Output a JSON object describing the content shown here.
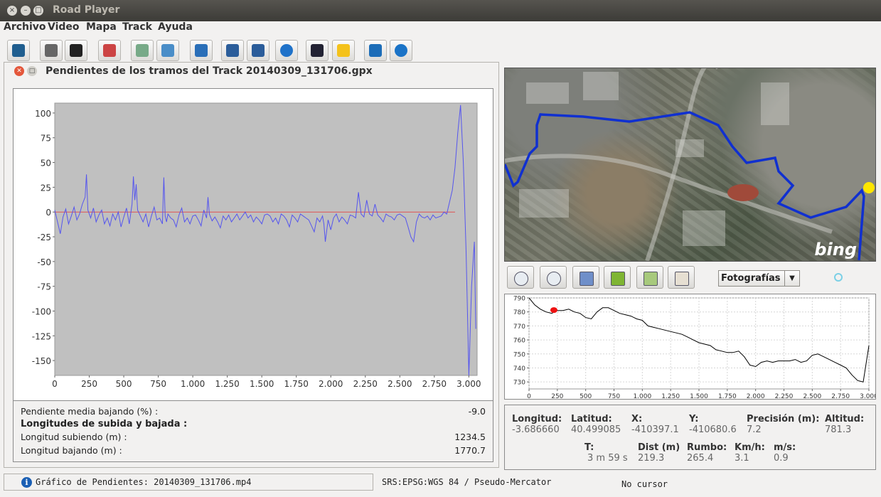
{
  "window": {
    "title": "Road Player"
  },
  "menu": [
    "Archivo",
    "Video",
    "Mapa",
    "Track",
    "Ayuda"
  ],
  "toolbar": {
    "buttons": [
      {
        "name": "open-video-icon",
        "color": "#1f5e8f"
      },
      {
        "name": "camera-icon",
        "color": "#666"
      },
      {
        "name": "film-icon",
        "color": "#222"
      },
      {
        "name": "map-pin-icon",
        "color": "#c44"
      },
      {
        "name": "database-add-icon",
        "color": "#7a8"
      },
      {
        "name": "layers-icon",
        "color": "#4a8ec8"
      },
      {
        "name": "chart-icon",
        "color": "#2a6fb8"
      },
      {
        "name": "save-icon",
        "color": "#2b5d9a"
      },
      {
        "name": "save-as-icon",
        "color": "#2b5d9a"
      },
      {
        "name": "globe-icon",
        "color": "#1f72c9"
      },
      {
        "name": "pen-icon",
        "color": "#223"
      },
      {
        "name": "waypoint-sign-icon",
        "color": "#f4c21b"
      },
      {
        "name": "help-book-icon",
        "color": "#1c6db8"
      },
      {
        "name": "info-icon",
        "color": "#1a73c7"
      }
    ]
  },
  "slope_window": {
    "title": "Pendientes de los tramos del Track 20140309_131706.gpx",
    "stats": {
      "mean_down_label": "Pendiente media bajando (%) :",
      "mean_down_value": "-9.0",
      "section_title": "Longitudes de subida y bajada :",
      "up_label": "Longitud subiendo (m) :",
      "up_value": "1234.5",
      "down_label": "Longitud bajando (m) :",
      "down_value": "1770.7"
    }
  },
  "chart_data": [
    {
      "type": "line",
      "title": "",
      "xlabel": "",
      "ylabel": "",
      "xlim": [
        0,
        3060
      ],
      "ylim": [
        -165,
        110
      ],
      "x_ticks": [
        "0",
        "250",
        "500",
        "750",
        "1.000",
        "1.250",
        "1.500",
        "1.750",
        "2.000",
        "2.250",
        "2.500",
        "2.750",
        "3.000"
      ],
      "y_ticks": [
        "100",
        "75",
        "50",
        "25",
        "0",
        "-25",
        "-50",
        "-75",
        "-100",
        "-125",
        "-150"
      ],
      "grid": false,
      "background": "#c0c0c0",
      "reference_line": {
        "y": 0,
        "color": "#e05050"
      },
      "series": [
        {
          "color": "#5555ee",
          "x": [
            0,
            20,
            40,
            60,
            80,
            100,
            120,
            140,
            160,
            180,
            200,
            220,
            230,
            240,
            260,
            280,
            300,
            320,
            340,
            360,
            380,
            400,
            420,
            440,
            460,
            480,
            500,
            520,
            540,
            560,
            570,
            580,
            590,
            600,
            620,
            640,
            660,
            680,
            700,
            720,
            740,
            760,
            780,
            790,
            800,
            810,
            820,
            840,
            860,
            880,
            900,
            920,
            940,
            960,
            980,
            1000,
            1020,
            1040,
            1060,
            1080,
            1100,
            1110,
            1120,
            1140,
            1160,
            1180,
            1200,
            1220,
            1240,
            1260,
            1280,
            1300,
            1320,
            1340,
            1360,
            1380,
            1400,
            1420,
            1440,
            1460,
            1480,
            1500,
            1520,
            1540,
            1560,
            1580,
            1600,
            1620,
            1640,
            1660,
            1680,
            1700,
            1720,
            1740,
            1760,
            1780,
            1800,
            1820,
            1840,
            1860,
            1880,
            1900,
            1920,
            1940,
            1950,
            1960,
            1980,
            2000,
            2020,
            2040,
            2060,
            2080,
            2100,
            2120,
            2140,
            2160,
            2180,
            2200,
            2220,
            2240,
            2260,
            2280,
            2300,
            2320,
            2340,
            2360,
            2380,
            2400,
            2420,
            2440,
            2460,
            2480,
            2500,
            2520,
            2540,
            2560,
            2580,
            2600,
            2620,
            2640,
            2660,
            2680,
            2700,
            2720,
            2740,
            2760,
            2780,
            2800,
            2820,
            2840,
            2860,
            2880,
            2900,
            2920,
            2940,
            2960,
            2980,
            3000,
            3020,
            3040,
            3050
          ],
          "y": [
            2,
            -10,
            -22,
            -5,
            3,
            -12,
            -4,
            5,
            -8,
            -2,
            8,
            15,
            38,
            2,
            -6,
            4,
            -10,
            -3,
            2,
            -12,
            -6,
            -14,
            -2,
            -8,
            0,
            -15,
            -5,
            4,
            -12,
            8,
            36,
            12,
            28,
            2,
            -4,
            -10,
            -2,
            -15,
            -4,
            5,
            -8,
            -6,
            -12,
            35,
            -4,
            -10,
            -2,
            -6,
            -8,
            -15,
            -3,
            4,
            -10,
            -6,
            -12,
            -4,
            -3,
            -8,
            -14,
            2,
            -6,
            15,
            -2,
            -9,
            -5,
            -10,
            -16,
            -4,
            -8,
            -3,
            -10,
            -6,
            -2,
            -8,
            -4,
            0,
            -6,
            -3,
            -10,
            -5,
            -8,
            -12,
            -3,
            -2,
            -4,
            -10,
            -6,
            -12,
            -2,
            -4,
            -8,
            -15,
            -3,
            -6,
            -10,
            -2,
            -4,
            -6,
            -8,
            -14,
            -20,
            -6,
            -10,
            -4,
            -12,
            -30,
            -8,
            -18,
            -6,
            -2,
            -10,
            -5,
            -8,
            -12,
            -3,
            -4,
            -6,
            20,
            -2,
            -5,
            12,
            -2,
            -4,
            8,
            -3,
            -6,
            -10,
            -2,
            -4,
            -5,
            -8,
            -3,
            -2,
            -4,
            -6,
            -15,
            -25,
            -30,
            -10,
            -2,
            -5,
            -6,
            -4,
            -8,
            -3,
            -6,
            -5,
            -4,
            0,
            -2,
            10,
            22,
            45,
            80,
            108,
            50,
            -40,
            -165,
            -75,
            -30,
            -118
          ]
        }
      ]
    },
    {
      "type": "line",
      "title": "",
      "xlabel": "",
      "ylabel": "",
      "xlim": [
        0,
        3000
      ],
      "ylim": [
        725,
        790
      ],
      "x_ticks": [
        "0",
        "250",
        "500",
        "750",
        "1.000",
        "1.250",
        "1.500",
        "1.750",
        "2.000",
        "2.250",
        "2.500",
        "2.750",
        "3.000"
      ],
      "y_ticks": [
        "790",
        "780",
        "770",
        "760",
        "750",
        "740",
        "730"
      ],
      "grid": true,
      "current_position": {
        "x": 219.3,
        "y": 781.3,
        "color": "#ee1111"
      },
      "series": [
        {
          "color": "#000000",
          "x": [
            0,
            50,
            100,
            150,
            200,
            250,
            300,
            350,
            400,
            450,
            500,
            550,
            600,
            650,
            700,
            750,
            800,
            850,
            900,
            950,
            1000,
            1050,
            1100,
            1150,
            1200,
            1250,
            1300,
            1350,
            1400,
            1450,
            1500,
            1550,
            1600,
            1650,
            1700,
            1750,
            1800,
            1850,
            1900,
            1950,
            2000,
            2050,
            2100,
            2150,
            2200,
            2250,
            2300,
            2350,
            2400,
            2450,
            2500,
            2550,
            2600,
            2650,
            2700,
            2750,
            2800,
            2850,
            2900,
            2950,
            3000
          ],
          "y": [
            790,
            785,
            782,
            780,
            779,
            781,
            781,
            782,
            780,
            779,
            776,
            775,
            780,
            783,
            783,
            781,
            779,
            778,
            777,
            775,
            774,
            770,
            769,
            768,
            767,
            766,
            765,
            764,
            762,
            760,
            758,
            757,
            756,
            753,
            752,
            751,
            751,
            752,
            748,
            742,
            741,
            744,
            745,
            744,
            745,
            745,
            745,
            746,
            744,
            745,
            749,
            750,
            748,
            746,
            744,
            742,
            740,
            735,
            731,
            730,
            756
          ]
        }
      ]
    }
  ],
  "map": {
    "provider_logo": "bing",
    "route_color": "#1030d0",
    "marker_color": "#ffe600"
  },
  "map_controls": {
    "buttons": [
      "zoom-in-icon",
      "zoom-out-icon",
      "pan-icon",
      "spain-map-icon",
      "region-map-icon",
      "map-icon"
    ],
    "layer_select": "Fotografías"
  },
  "track_info": {
    "longitud_label": "Longitud:",
    "longitud": "-3.686660",
    "latitud_label": "Latitud:",
    "latitud": "40.499085",
    "x_label": "X:",
    "x": "-410397.1",
    "y_label": "Y:",
    "y": "-410680.6",
    "precision_label": "Precisión (m):",
    "precision": "7.2",
    "altitud_label": "Altitud:",
    "altitud": "781.3",
    "t_label": "T:",
    "t": "3 m 59 s",
    "dist_label": "Dist (m)",
    "dist": "219.3",
    "rumbo_label": "Rumbo:",
    "rumbo": "265.4",
    "kmh_label": "Km/h:",
    "kmh": "3.1",
    "ms_label": "m/s:",
    "ms": "0.9"
  },
  "status": {
    "message": "Gráfico de Pendientes: 20140309_131706.mp4",
    "srs": "SRS:EPSG:WGS 84 / Pseudo-Mercator",
    "cursor": "No cursor"
  }
}
